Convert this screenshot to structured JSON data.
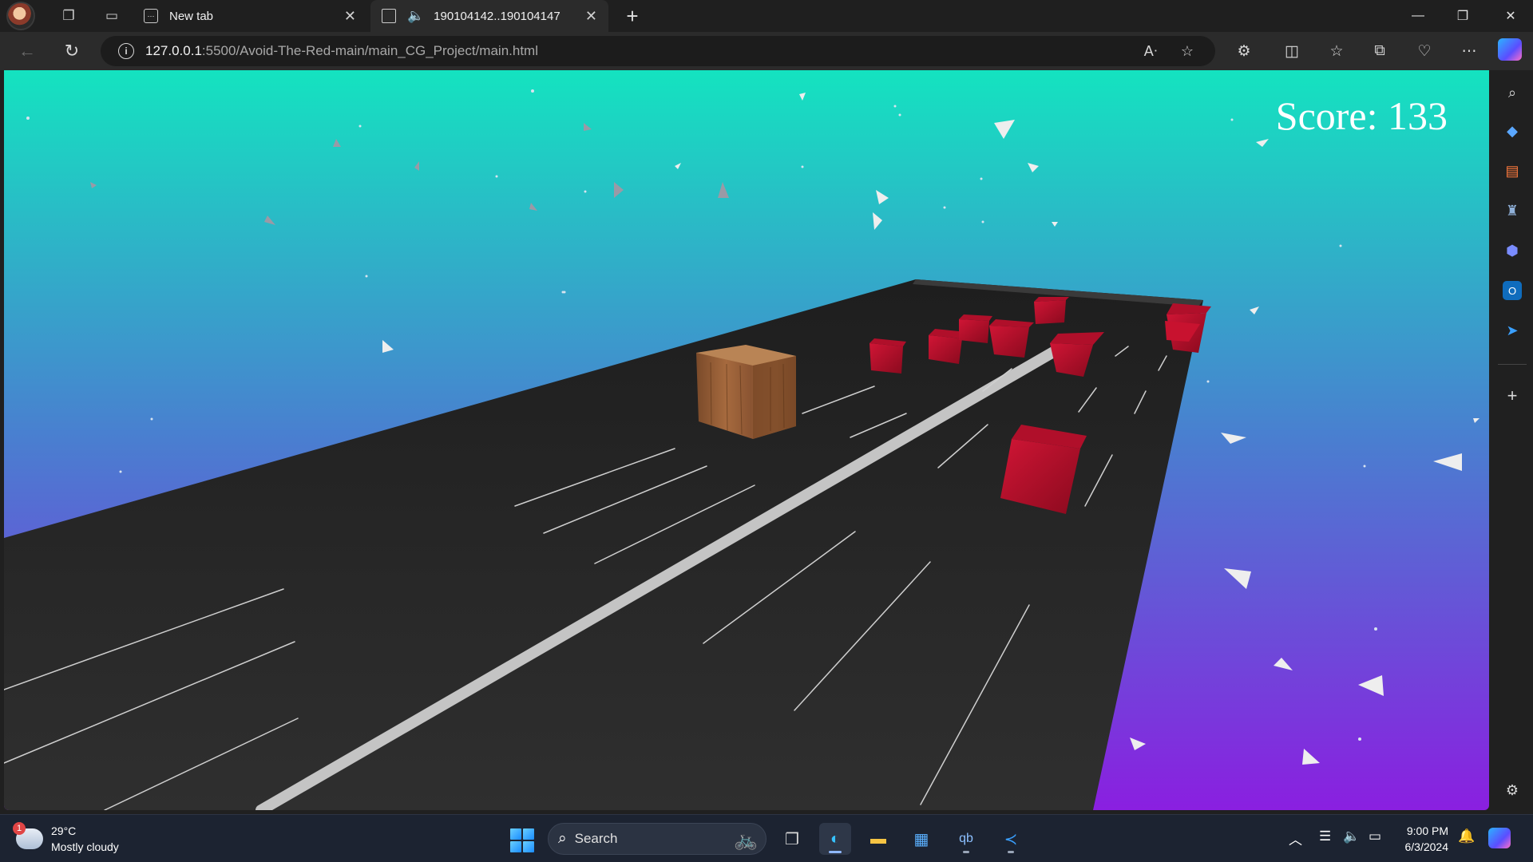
{
  "browser": {
    "tabs": [
      {
        "label": "New tab"
      },
      {
        "label": "190104142..190104147"
      }
    ],
    "url_host": "127.0.0.1",
    "url_path": ":5500/Avoid-The-Red-main/main_CG_Project/main.html"
  },
  "game": {
    "score_text": "Score: 133",
    "colors": {
      "sky_top": "#14e3c0",
      "sky_mid": "#4a7ed0",
      "sky_bottom": "#8a1fe0",
      "road": "#2c2c2c",
      "obstacle": "#c0102c",
      "player": "#9c6239"
    }
  },
  "sidebar": {
    "icons": [
      "search-icon",
      "tag-icon",
      "toolbox-icon",
      "chess-icon",
      "copilot-icon",
      "outlook-icon",
      "send-icon",
      "add-icon",
      "settings-icon"
    ]
  },
  "taskbar": {
    "weather_temp": "29°C",
    "weather_desc": "Mostly cloudy",
    "weather_badge": "1",
    "search_label": "Search",
    "time": "9:00 PM",
    "date": "6/3/2024"
  }
}
